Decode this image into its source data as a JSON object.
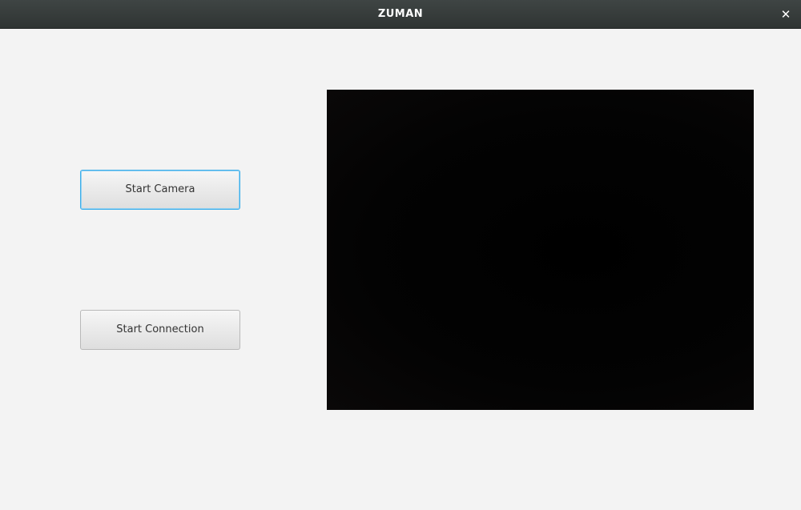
{
  "window": {
    "title": "ZUMAN",
    "close_icon": "close-icon"
  },
  "controls": {
    "start_camera_label": "Start Camera",
    "start_connection_label": "Start Connection"
  },
  "video_feed": {
    "state": "dark frame",
    "background_color": "#000000"
  },
  "colors": {
    "titlebar": "#373c3b",
    "focus_accent": "#3daee9",
    "window_background": "#f3f3f3"
  }
}
